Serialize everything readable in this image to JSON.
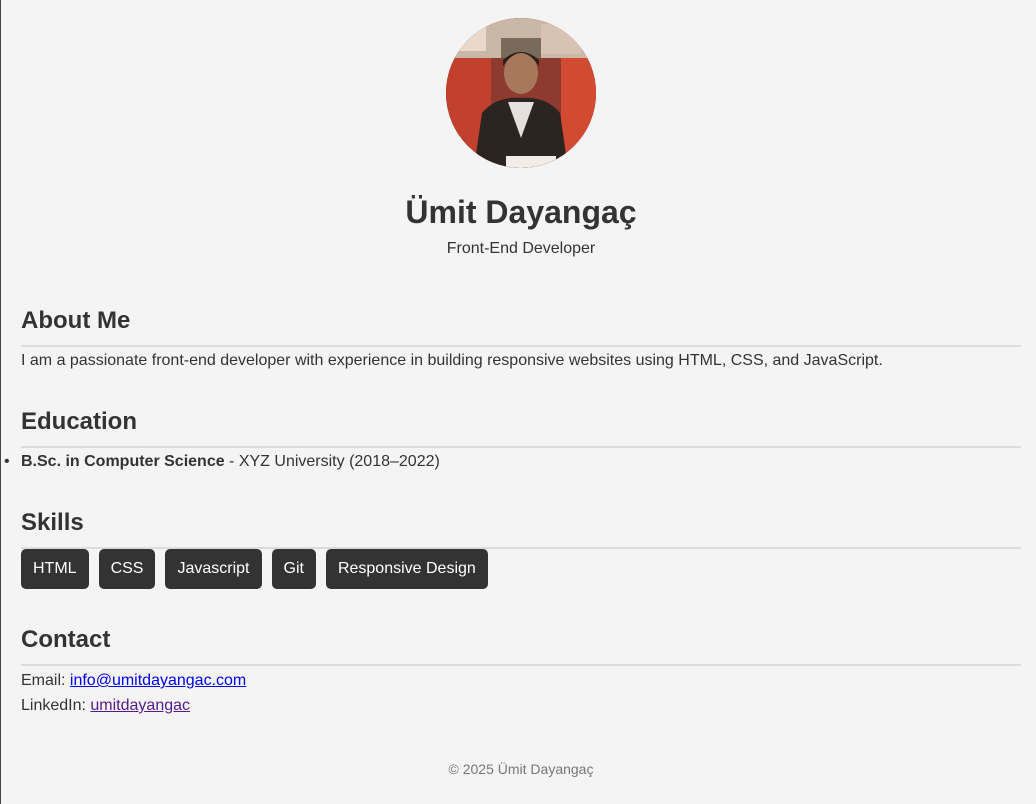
{
  "profile": {
    "name": "Ümit Dayangaç",
    "role": "Front-End Developer"
  },
  "about": {
    "heading": "About Me",
    "text": "I am a passionate front-end developer with experience in building responsive websites using HTML, CSS, and JavaScript."
  },
  "education": {
    "heading": "Education",
    "items": [
      {
        "degree": "B.Sc. in Computer Science",
        "detail": " - XYZ University (2018–2022)"
      }
    ]
  },
  "skills": {
    "heading": "Skills",
    "tags": [
      "HTML",
      "CSS",
      "Javascript",
      "Git",
      "Responsive Design"
    ]
  },
  "contact": {
    "heading": "Contact",
    "email_label": "Email: ",
    "email": "info@umitdayangac.com",
    "linkedin_label": "LinkedIn: ",
    "linkedin": "umitdayangac"
  },
  "footer": {
    "text": "© 2025 Ümit Dayangaç"
  },
  "colors": {
    "background": "#f4f4f4",
    "text": "#333333",
    "tag_bg": "#333333",
    "tag_text": "#ffffff",
    "link": "#0000ee",
    "link_visited": "#551a8b"
  }
}
